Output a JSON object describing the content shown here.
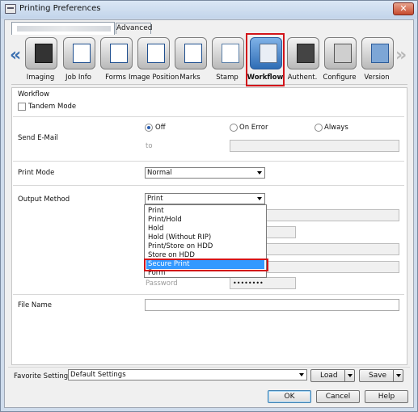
{
  "window": {
    "title": "Printing Preferences",
    "close_label": "✕"
  },
  "tabs": {
    "main_label": "",
    "advanced_label": "Advanced"
  },
  "categories": [
    {
      "label": "Imaging",
      "icon": "imaging-icon"
    },
    {
      "label": "Job Info",
      "icon": "job-info-icon"
    },
    {
      "label": "Forms",
      "icon": "forms-icon"
    },
    {
      "label": "Image Position",
      "icon": "image-position-icon"
    },
    {
      "label": "Marks",
      "icon": "marks-icon"
    },
    {
      "label": "Stamp",
      "icon": "stamp-icon"
    },
    {
      "label": "Workflow",
      "icon": "workflow-icon",
      "active": true
    },
    {
      "label": "Authent.",
      "icon": "authentication-icon"
    },
    {
      "label": "Configure",
      "icon": "configure-icon"
    },
    {
      "label": "Version",
      "icon": "version-icon"
    }
  ],
  "nav": {
    "left": "«",
    "right": "»"
  },
  "workflow": {
    "section_title": "Workflow",
    "tandem_mode_label": "Tandem Mode",
    "tandem_mode_checked": false
  },
  "send_email": {
    "label": "Send E-Mail",
    "options": [
      "Off",
      "On Error",
      "Always"
    ],
    "selected": "Off",
    "to_label": "to",
    "to_value": ""
  },
  "print_mode": {
    "label": "Print Mode",
    "value": "Normal"
  },
  "output_method": {
    "label": "Output Method",
    "value": "Print",
    "options": [
      "Print",
      "Print/Hold",
      "Hold",
      "Hold (Without RIP)",
      "Print/Store on HDD",
      "Store on HDD",
      "Secure Print",
      "Form"
    ],
    "highlighted": "Secure Print",
    "password_label": "Password",
    "password_value": "••••••••"
  },
  "file_name": {
    "label": "File Name",
    "value": ""
  },
  "favorite": {
    "label": "Favorite Setting",
    "value": "Default Settings",
    "load_label": "Load",
    "save_label": "Save"
  },
  "buttons": {
    "ok": "OK",
    "cancel": "Cancel",
    "help": "Help"
  },
  "colors": {
    "selection": "#3399ff",
    "highlight_frame": "#d2141a",
    "accent": "#3a6fb0"
  }
}
